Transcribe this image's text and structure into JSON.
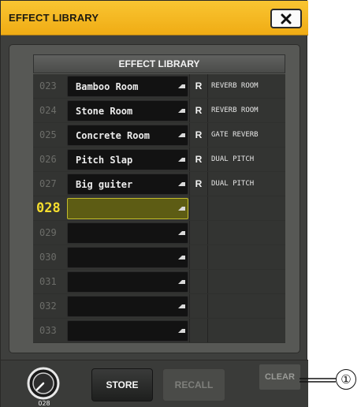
{
  "window": {
    "title": "EFFECT LIBRARY",
    "accent_color": "#f4b820"
  },
  "library": {
    "header": "EFFECT LIBRARY",
    "rows": [
      {
        "number": "023",
        "name": "Bamboo Room",
        "read_only_mark": "R",
        "effect_type": "REVERB ROOM"
      },
      {
        "number": "024",
        "name": "Stone Room",
        "read_only_mark": "R",
        "effect_type": "REVERB ROOM"
      },
      {
        "number": "025",
        "name": "Concrete Room",
        "read_only_mark": "R",
        "effect_type": "GATE REVERB"
      },
      {
        "number": "026",
        "name": "Pitch Slap",
        "read_only_mark": "R",
        "effect_type": "DUAL PITCH"
      },
      {
        "number": "027",
        "name": "Big guiter",
        "read_only_mark": "R",
        "effect_type": "DUAL PITCH"
      },
      {
        "number": "028",
        "name": "",
        "read_only_mark": "",
        "effect_type": "",
        "selected": true
      },
      {
        "number": "029",
        "name": "",
        "read_only_mark": "",
        "effect_type": ""
      },
      {
        "number": "030",
        "name": "",
        "read_only_mark": "",
        "effect_type": ""
      },
      {
        "number": "031",
        "name": "",
        "read_only_mark": "",
        "effect_type": ""
      },
      {
        "number": "032",
        "name": "",
        "read_only_mark": "",
        "effect_type": ""
      },
      {
        "number": "033",
        "name": "",
        "read_only_mark": "",
        "effect_type": ""
      }
    ]
  },
  "footer": {
    "knob_value": "028",
    "store_label": "STORE",
    "recall_label": "RECALL",
    "clear_label": "CLEAR"
  },
  "callout": {
    "label": "①"
  },
  "icons": {
    "close": "close-icon",
    "edit": "edit-icon",
    "knob": "selector-knob-icon"
  }
}
